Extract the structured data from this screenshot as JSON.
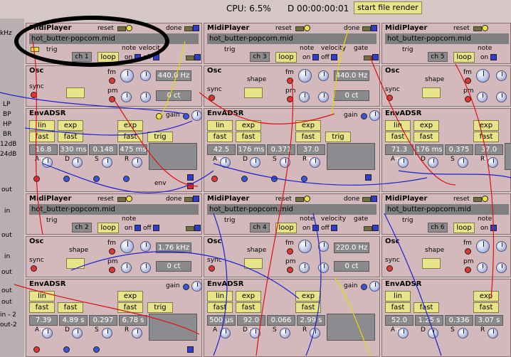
{
  "topbar": {
    "cpu": "CPU: 6.5%",
    "clock": "D 00:00:00:01",
    "render_label": "start file render"
  },
  "left_strip": [
    "kHz",
    "LP",
    "BP",
    "HP",
    "BR",
    "12dB",
    "24dB",
    "out",
    "in",
    "out",
    "in",
    "out",
    "out",
    "out",
    "in - 2",
    "out-2"
  ],
  "midi_title": "MidiPlayer",
  "osc_title": "Osc",
  "env_title": "EnvADSR",
  "labels": {
    "reset": "reset",
    "done": "done",
    "trig": "trig",
    "note": "note",
    "velocity": "velocity",
    "velocity_short": "velocit",
    "gate": "gate",
    "on": "on",
    "off": "off",
    "loop": "loop",
    "fm": "fm",
    "pm": "pm",
    "shape": "shape",
    "sync": "sync",
    "gain": "gain",
    "env": "env",
    "lin": "lin",
    "exp": "exp",
    "fast": "fast",
    "trig_btn": "trig",
    "A": "A",
    "D": "D",
    "S": "S",
    "R": "R",
    "sync_short": "sync"
  },
  "midi": [
    {
      "file": "hot_butter-popcorn.mid",
      "channel": "ch 1"
    },
    {
      "file": "hot_butter-popcorn.mid",
      "channel": "ch 3"
    },
    {
      "file": "hot_butter-popcorn.mid",
      "channel": "ch 5"
    },
    {
      "file": "hot_butter-popcorn.mid",
      "channel": "ch 2"
    },
    {
      "file": "hot_butter-popcorn.mid",
      "channel": "ch 4"
    },
    {
      "file": "hot_butter-popcorn.mid",
      "channel": "ch 6"
    }
  ],
  "osc": [
    {
      "freq": "440.0 Hz",
      "cents": "0 ct"
    },
    {
      "freq": "440.0 Hz",
      "cents": "0 ct"
    },
    {
      "freq": "",
      "cents": ""
    },
    {
      "freq": "1.76 kHz",
      "cents": "0 ct"
    },
    {
      "freq": "220.0 Hz",
      "cents": "0 ct"
    },
    {
      "freq": "",
      "cents": ""
    }
  ],
  "env": [
    {
      "a": "16.8 ms",
      "d": "330 ms",
      "s": "0.148",
      "r": "475 ms"
    },
    {
      "a": "42.5 ms",
      "d": "176 ms",
      "s": "0.371",
      "r": "37.0 ms"
    },
    {
      "a": "71.3 ms",
      "d": "176 ms",
      "s": "0.375",
      "r": "37.0 ms"
    },
    {
      "a": "7.39 ms",
      "d": "4.89 s",
      "s": "0.297",
      "r": "6.78 s"
    },
    {
      "a": "500 µs",
      "d": "92.0 ms",
      "s": "0.066",
      "r": "2.99 s"
    },
    {
      "a": "52.0 ms",
      "d": "1.25 s",
      "s": "0.336",
      "r": "3.07 s"
    }
  ],
  "colors": {
    "accent_yellow": "#e8e48a",
    "panel": "#d3b9bc",
    "wire_red": "#e01010",
    "wire_blue": "#2020d0",
    "wire_yellow": "#e6d700"
  }
}
